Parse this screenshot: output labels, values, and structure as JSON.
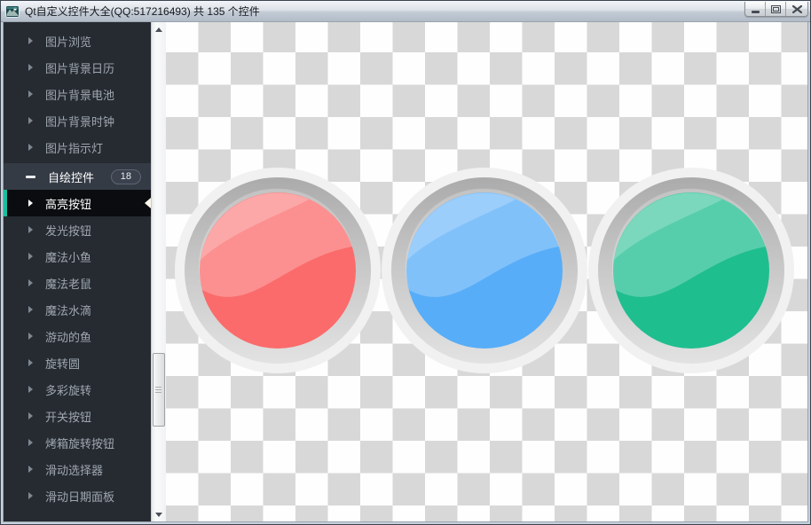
{
  "window": {
    "title": "Qt自定义控件大全(QQ:517216493) 共 135 个控件"
  },
  "sidebar": {
    "items": [
      {
        "label": "图片浏览"
      },
      {
        "label": "图片背景日历"
      },
      {
        "label": "图片背景电池"
      },
      {
        "label": "图片背景时钟"
      },
      {
        "label": "图片指示灯"
      },
      {
        "label": "自绘控件",
        "badge": "18",
        "expanded": true
      }
    ],
    "children": [
      {
        "label": "高亮按钮",
        "selected": true
      },
      {
        "label": "发光按钮"
      },
      {
        "label": "魔法小鱼"
      },
      {
        "label": "魔法老鼠"
      },
      {
        "label": "魔法水滴"
      },
      {
        "label": "游动的鱼"
      },
      {
        "label": "旋转圆"
      },
      {
        "label": "多彩旋转"
      },
      {
        "label": "开关按钮"
      },
      {
        "label": "烤箱旋转按钮"
      },
      {
        "label": "滑动选择器"
      },
      {
        "label": "滑动日期面板"
      }
    ],
    "colors": {
      "panel_bg": "#262B32",
      "selected_bg": "#0A0C0F",
      "selection_accent": "#1ABC9C",
      "current_arrow": "#FBF8EA"
    }
  },
  "main": {
    "checkerboard": {
      "light": "#FEFEFE",
      "dark": "#D8D8D8"
    },
    "glossy_buttons": [
      {
        "name": "red",
        "color": "#FB6B6B"
      },
      {
        "name": "blue",
        "color": "#57ADF8"
      },
      {
        "name": "green",
        "color": "#1FBE8F"
      }
    ],
    "ring_colors": {
      "glow": "#F1F1F1",
      "ring_top": "#ABABAB",
      "ring_bottom": "#E2E2E2"
    }
  }
}
